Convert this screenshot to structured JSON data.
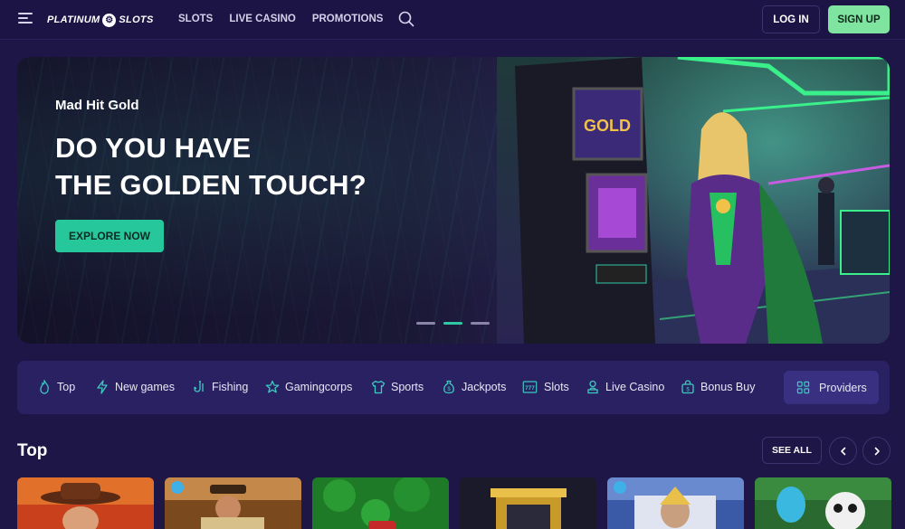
{
  "header": {
    "logo_left": "PLATINUM",
    "logo_right": "SLOTS",
    "logo_mark": "⚙",
    "nav": [
      "SLOTS",
      "LIVE CASINO",
      "PROMOTIONS"
    ],
    "login_label": "LOG IN",
    "signup_label": "SIGN UP"
  },
  "hero": {
    "subtitle": "Mad Hit Gold",
    "title_line1": "DO YOU HAVE",
    "title_line2": "THE GOLDEN TOUCH?",
    "cta_label": "EXPLORE NOW",
    "slides": 3,
    "active_slide": 2
  },
  "categories": {
    "items": [
      {
        "label": "Top",
        "icon": "flame-icon"
      },
      {
        "label": "New games",
        "icon": "lightning-icon"
      },
      {
        "label": "Fishing",
        "icon": "fishhook-icon"
      },
      {
        "label": "Gamingcorps",
        "icon": "star-icon"
      },
      {
        "label": "Sports",
        "icon": "shirt-icon"
      },
      {
        "label": "Jackpots",
        "icon": "money-bag-icon"
      },
      {
        "label": "Slots",
        "icon": "777-icon"
      },
      {
        "label": "Live Casino",
        "icon": "dealer-icon"
      },
      {
        "label": "Bonus Buy",
        "icon": "gift-bag-icon"
      }
    ],
    "providers_label": "Providers"
  },
  "top_section": {
    "title": "Top",
    "see_all_label": "SEE ALL"
  },
  "colors": {
    "background": "#1e1646",
    "accent_green": "#27c79c",
    "signup_green": "#7ee4a0",
    "panel": "#2a2163",
    "icon_teal": "#3ec8c0"
  }
}
